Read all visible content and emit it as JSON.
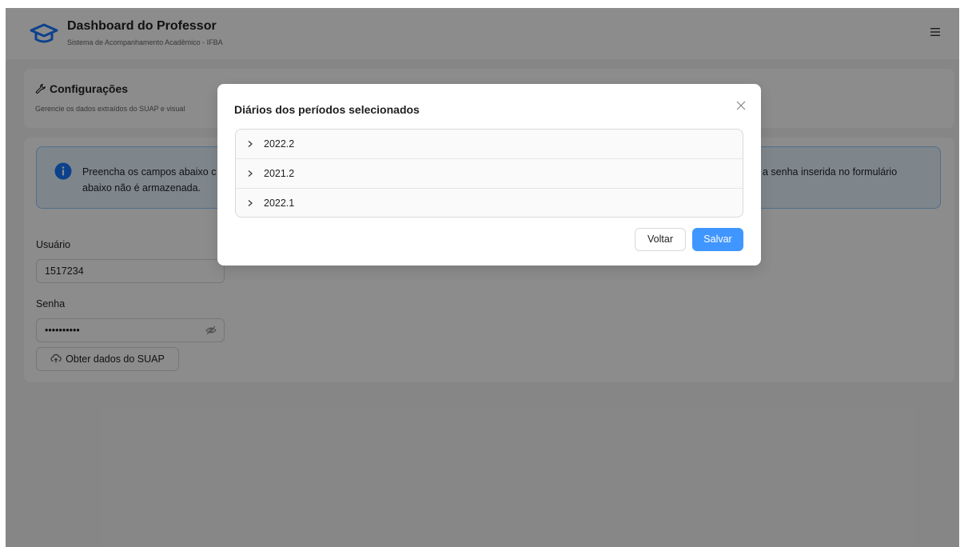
{
  "colors": {
    "primary": "#4096ff",
    "alert_background": "#e6f4ff",
    "alert_border": "#91caff",
    "alert_icon": "#1677ff"
  },
  "header": {
    "title": "Dashboard do Professor",
    "subtitle": "Sistema de Acompanhamento Acadêmico - IFBA",
    "logo_icon": "graduation-cap-icon",
    "menu_icon": "hamburger-menu-icon"
  },
  "config": {
    "title": "Configurações",
    "title_icon": "wrench-icon",
    "description": "Gerencie os dados extraídos do SUAP e visual"
  },
  "alert": {
    "icon": "info-circle-icon",
    "text_left": "Preencha os campos abaixo c",
    "text_right": "a senha inserida no formulário",
    "text_line2": "abaixo não é armazenada."
  },
  "form": {
    "username_label": "Usuário",
    "username_value": "1517234",
    "password_label": "Senha",
    "password_value": "••••••••••",
    "password_toggle_icon": "eye-slash-icon",
    "fetch_button_label": "Obter dados do SUAP",
    "fetch_button_icon": "cloud-icon"
  },
  "modal": {
    "title": "Diários dos períodos selecionados",
    "close_icon": "close-icon",
    "periods": [
      {
        "label": "2022.2"
      },
      {
        "label": "2021.2"
      },
      {
        "label": "2022.1"
      }
    ],
    "back_label": "Voltar",
    "save_label": "Salvar"
  }
}
